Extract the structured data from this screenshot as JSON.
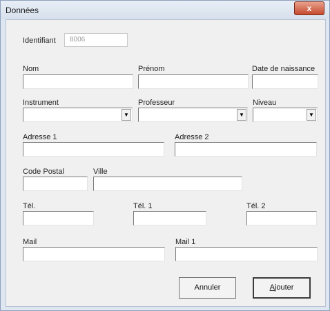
{
  "window": {
    "title": "Données",
    "close_label": "x"
  },
  "form": {
    "identifiant": {
      "label": "Identifiant",
      "value": "8006"
    },
    "nom": {
      "label": "Nom",
      "value": ""
    },
    "prenom": {
      "label": "Prénom",
      "value": ""
    },
    "date_naissance": {
      "label": "Date de naissance",
      "value": ""
    },
    "instrument": {
      "label": "Instrument",
      "value": ""
    },
    "professeur": {
      "label": "Professeur",
      "value": ""
    },
    "niveau": {
      "label": "Niveau",
      "value": ""
    },
    "adresse1": {
      "label": "Adresse 1",
      "value": ""
    },
    "adresse2": {
      "label": "Adresse 2",
      "value": ""
    },
    "code_postal": {
      "label": "Code Postal",
      "value": ""
    },
    "ville": {
      "label": "Ville",
      "value": ""
    },
    "tel": {
      "label": "Tél.",
      "value": ""
    },
    "tel1": {
      "label": "Tél. 1",
      "value": ""
    },
    "tel2": {
      "label": "Tél. 2",
      "value": ""
    },
    "mail": {
      "label": "Mail",
      "value": ""
    },
    "mail1": {
      "label": "Mail 1",
      "value": ""
    }
  },
  "buttons": {
    "annuler": "Annuler",
    "ajouter_accel": "A",
    "ajouter_rest": "jouter"
  },
  "icons": {
    "dropdown": "chevron-down-icon",
    "close": "close-icon"
  }
}
